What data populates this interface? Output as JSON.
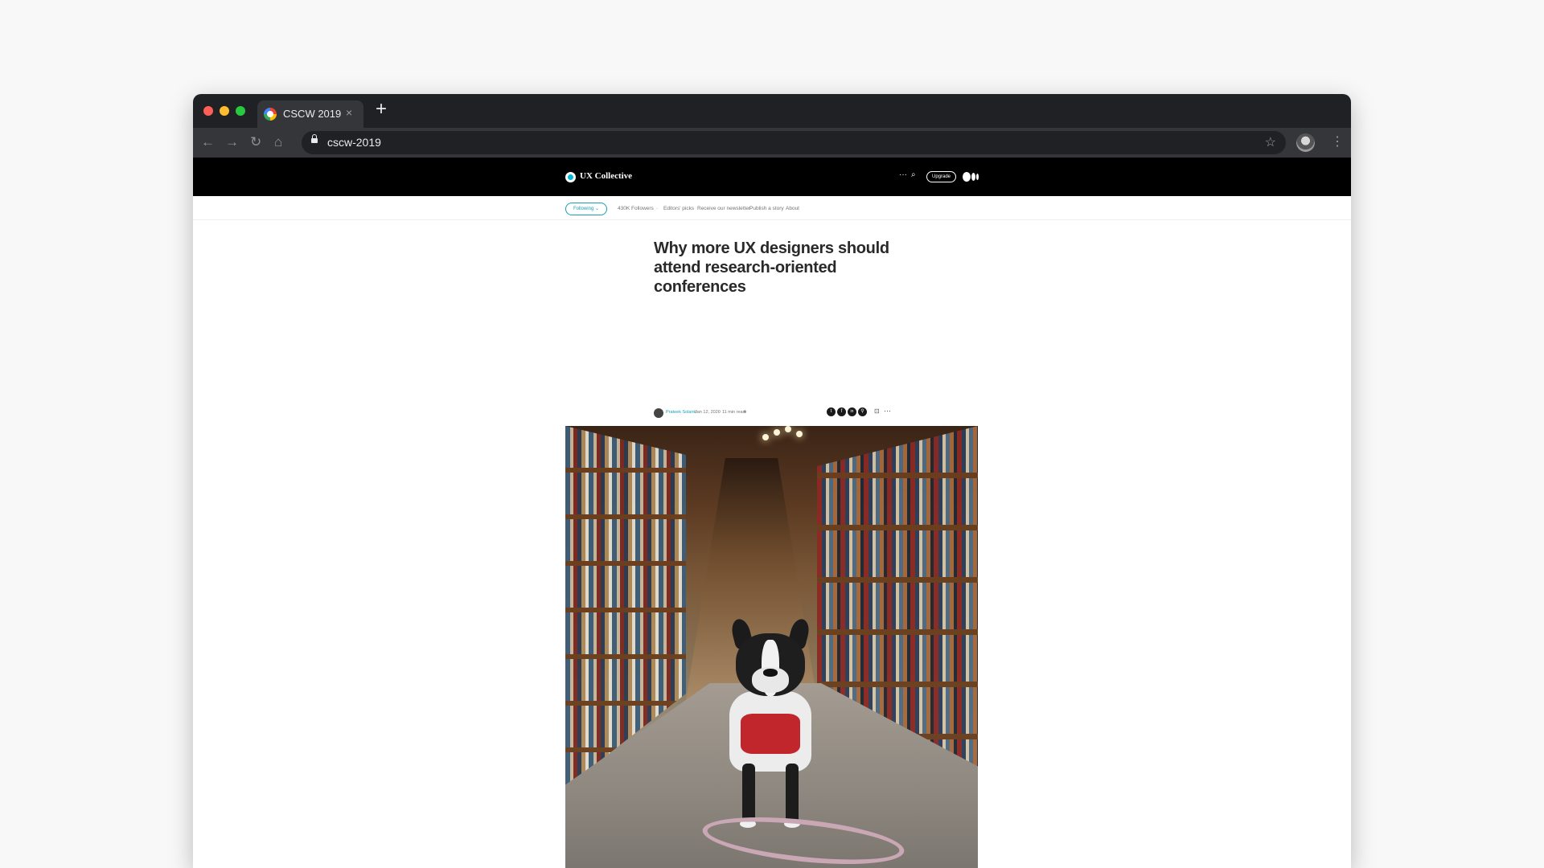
{
  "browser": {
    "tab_title": "CSCW 2019",
    "tab_close": "×",
    "new_tab": "+",
    "url": "cscw-2019",
    "nav": {
      "back": "←",
      "forward": "→",
      "reload": "↻",
      "home": "⌂"
    },
    "star": "☆",
    "menu": "⋮",
    "colors": {
      "frame": "#202124",
      "toolbar": "#35363a",
      "text": "#e8eaed"
    }
  },
  "site": {
    "publication": "UX Collective",
    "upgrade_label": "Upgrade",
    "more": "···",
    "search": "⌕",
    "accent": "#18a0b4"
  },
  "pub_nav": {
    "following_label": "Following ⌄",
    "followers": "430K Followers",
    "separator": "·",
    "links": [
      "Editors' picks",
      "Receive our newsletter",
      "Publish a story",
      "About"
    ]
  },
  "article": {
    "title": "Why more UX designers should attend research-oriented conferences",
    "author": "Prateek Solanki",
    "date": "Jan 12, 2020",
    "read_time": "11 min read",
    "star": "★",
    "share_icons": [
      "twitter-icon",
      "facebook-icon",
      "linkedin-icon",
      "link-icon"
    ],
    "share_glyphs": [
      "t",
      "f",
      "in",
      "⚲"
    ],
    "bookmark": "⊡",
    "more": "···"
  }
}
